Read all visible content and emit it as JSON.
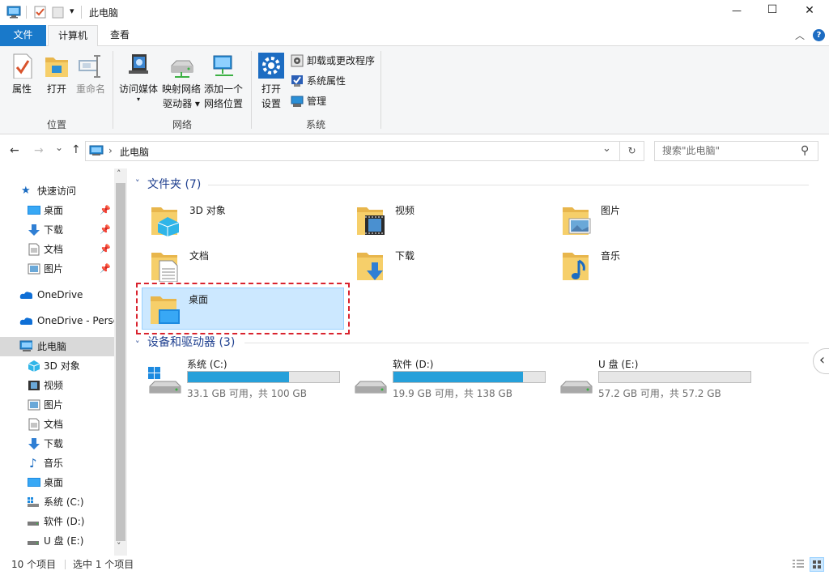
{
  "title_bar": {
    "title": "此电脑",
    "qa_dropdown": "▾",
    "minimize": "—",
    "maximize": "☐",
    "close": "✕"
  },
  "tabs": [
    {
      "label": "文件"
    },
    {
      "label": "计算机"
    },
    {
      "label": "查看"
    }
  ],
  "ribbon": {
    "collapse": "︿",
    "help": "?",
    "groups": {
      "location": "位置",
      "network": "网络",
      "system": "系统"
    },
    "location": {
      "properties": "属性",
      "open": "打开",
      "rename": "重命名"
    },
    "network": {
      "access_media": "访问媒体",
      "map_drive_1": "映射网络",
      "map_drive_2": "驱动器 ▾",
      "add_location_1": "添加一个",
      "add_location_2": "网络位置"
    },
    "system": {
      "open_settings_1": "打开",
      "open_settings_2": "设置",
      "uninstall": "卸载或更改程序",
      "sys_props": "系统属性",
      "manage": "管理"
    }
  },
  "address": {
    "back": "←",
    "forward": "→",
    "recent": "⌄",
    "up": "↑",
    "path_sep": "›",
    "path": "此电脑",
    "dropdown": "⌄",
    "refresh": "↻",
    "search_placeholder": "搜索\"此电脑\"",
    "search_icon": "⚲"
  },
  "nav": {
    "scroll_up": "˄",
    "scroll_down": "˅",
    "quick_access": "快速访问",
    "quick_items": [
      {
        "label": "桌面",
        "pin": "📌"
      },
      {
        "label": "下载",
        "pin": "📌"
      },
      {
        "label": "文档",
        "pin": "📌"
      },
      {
        "label": "图片",
        "pin": "📌"
      }
    ],
    "onedrive": "OneDrive",
    "onedrive_personal": "OneDrive - Personal",
    "this_pc": "此电脑",
    "pc_items": [
      {
        "label": "3D 对象"
      },
      {
        "label": "视频"
      },
      {
        "label": "图片"
      },
      {
        "label": "文档"
      },
      {
        "label": "下载"
      },
      {
        "label": "音乐"
      },
      {
        "label": "桌面"
      },
      {
        "label": "系统 (C:)"
      },
      {
        "label": "软件 (D:)"
      },
      {
        "label": "U 盘 (E:)"
      }
    ]
  },
  "content": {
    "folders_header": "文件夹 (7)",
    "folders": [
      {
        "label": "3D 对象"
      },
      {
        "label": "视频"
      },
      {
        "label": "图片"
      },
      {
        "label": "文档"
      },
      {
        "label": "下载"
      },
      {
        "label": "音乐"
      },
      {
        "label": "桌面"
      }
    ],
    "devices_header": "设备和驱动器 (3)",
    "drives": [
      {
        "name": "系统 (C:)",
        "sub": "33.1 GB 可用，共 100 GB",
        "used_fraction": 0.669
      },
      {
        "name": "软件 (D:)",
        "sub": "19.9 GB 可用，共 138 GB",
        "used_fraction": 0.856
      },
      {
        "name": "U 盘 (E:)",
        "sub": "57.2 GB 可用，共 57.2 GB",
        "used_fraction": 0.0
      }
    ],
    "side_collapse": "‹"
  },
  "status": {
    "count": "10 个项目",
    "selected": "选中 1 个项目"
  },
  "colors": {
    "accent": "#1979ca",
    "selection_bg": "#cce8ff",
    "selection_border": "#99d1ff",
    "highlight_dash": "#d9232e",
    "drive_fill": "#26a0da",
    "header_blue": "#1e3f8f"
  }
}
